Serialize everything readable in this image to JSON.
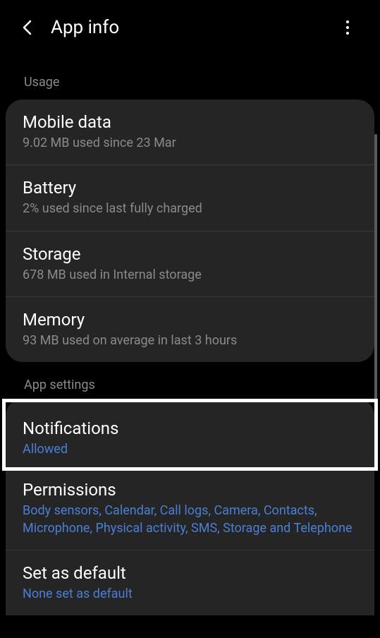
{
  "header": {
    "title": "App info"
  },
  "sections": {
    "usage": {
      "label": "Usage",
      "items": {
        "mobile_data": {
          "title": "Mobile data",
          "subtitle": "9.02 MB used since 23 Mar"
        },
        "battery": {
          "title": "Battery",
          "subtitle": "2% used since last fully charged"
        },
        "storage": {
          "title": "Storage",
          "subtitle": "678 MB used in Internal storage"
        },
        "memory": {
          "title": "Memory",
          "subtitle": "93 MB used on average in last 3 hours"
        }
      }
    },
    "app_settings": {
      "label": "App settings",
      "items": {
        "notifications": {
          "title": "Notifications",
          "subtitle": "Allowed"
        },
        "permissions": {
          "title": "Permissions",
          "subtitle": "Body sensors, Calendar, Call logs, Camera, Contacts, Microphone, Physical activity, SMS, Storage and Telephone"
        },
        "set_as_default": {
          "title": "Set as default",
          "subtitle": "None set as default"
        }
      }
    }
  }
}
